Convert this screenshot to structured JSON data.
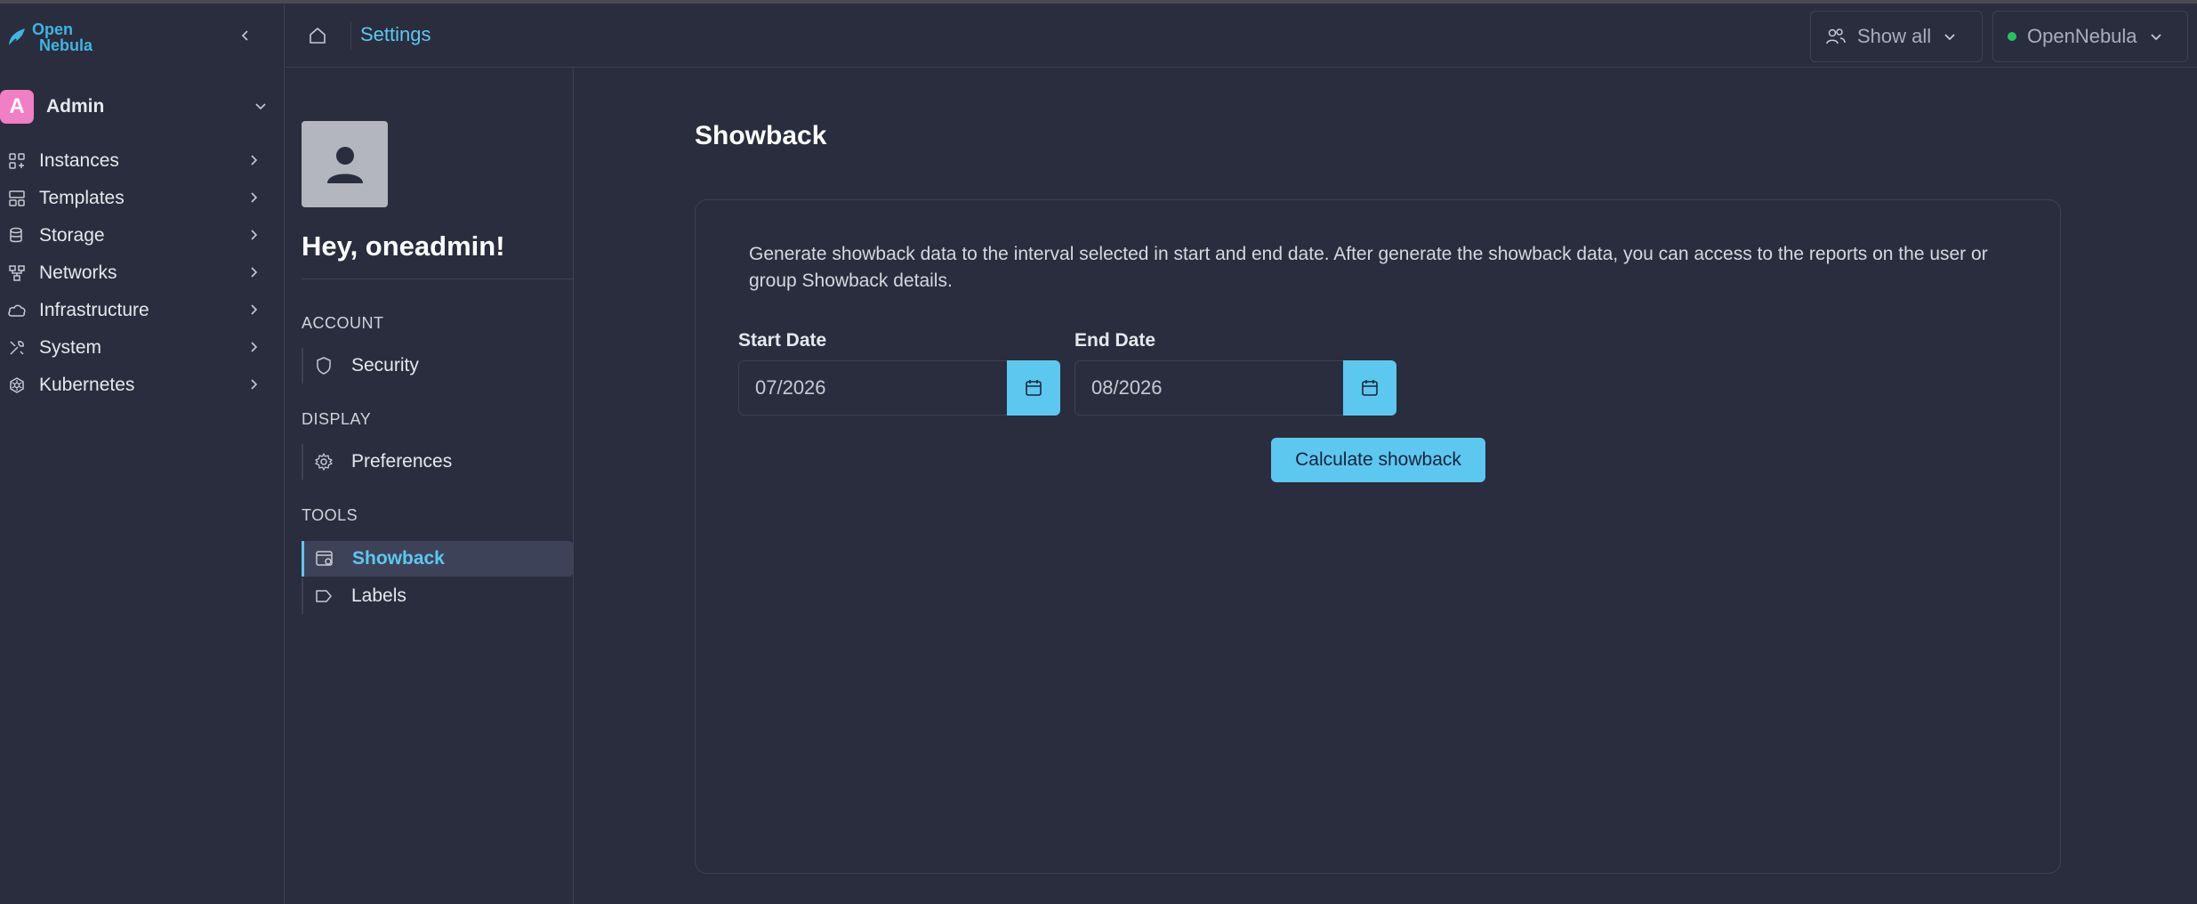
{
  "app": {
    "logo_text_line1": "Open",
    "logo_text_line2": "Nebula"
  },
  "user": {
    "initial": "A",
    "name": "Admin"
  },
  "sidebar": {
    "items": [
      {
        "label": "Instances",
        "icon": "instances-icon"
      },
      {
        "label": "Templates",
        "icon": "templates-icon"
      },
      {
        "label": "Storage",
        "icon": "storage-icon"
      },
      {
        "label": "Networks",
        "icon": "networks-icon"
      },
      {
        "label": "Infrastructure",
        "icon": "cloud-icon"
      },
      {
        "label": "System",
        "icon": "tools-icon"
      },
      {
        "label": "Kubernetes",
        "icon": "kubernetes-icon"
      }
    ]
  },
  "topbar": {
    "breadcrumb": "Settings",
    "group_filter": "Show all",
    "zone": "OpenNebula",
    "zone_status_color": "#22c55e"
  },
  "settings": {
    "greeting": "Hey, oneadmin!",
    "sections": [
      {
        "title": "ACCOUNT",
        "items": [
          {
            "label": "Security",
            "icon": "shield-icon"
          }
        ]
      },
      {
        "title": "DISPLAY",
        "items": [
          {
            "label": "Preferences",
            "icon": "gear-icon"
          }
        ]
      },
      {
        "title": "TOOLS",
        "items": [
          {
            "label": "Showback",
            "icon": "showback-icon",
            "active": true
          },
          {
            "label": "Labels",
            "icon": "label-icon"
          }
        ]
      }
    ]
  },
  "main": {
    "title": "Showback",
    "description": "Generate showback data to the interval selected in start and end date. After generate the showback data, you can access to the reports on the user or group Showback details.",
    "start_date_label": "Start Date",
    "start_date_value": "07/2026",
    "end_date_label": "End Date",
    "end_date_value": "08/2026",
    "calculate_button": "Calculate showback"
  },
  "colors": {
    "background": "#2a2d3d",
    "accent": "#5cc8f0",
    "avatar": "#f07fc3"
  }
}
